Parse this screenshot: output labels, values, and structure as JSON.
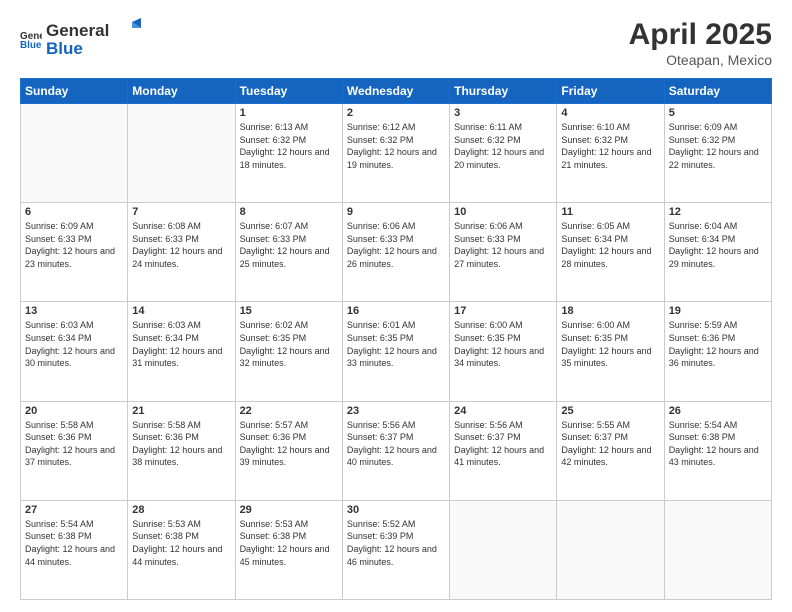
{
  "header": {
    "logo_general": "General",
    "logo_blue": "Blue",
    "title": "April 2025",
    "location": "Oteapan, Mexico"
  },
  "days_of_week": [
    "Sunday",
    "Monday",
    "Tuesday",
    "Wednesday",
    "Thursday",
    "Friday",
    "Saturday"
  ],
  "weeks": [
    [
      {
        "day": "",
        "info": ""
      },
      {
        "day": "",
        "info": ""
      },
      {
        "day": "1",
        "info": "Sunrise: 6:13 AM\nSunset: 6:32 PM\nDaylight: 12 hours and 18 minutes."
      },
      {
        "day": "2",
        "info": "Sunrise: 6:12 AM\nSunset: 6:32 PM\nDaylight: 12 hours and 19 minutes."
      },
      {
        "day": "3",
        "info": "Sunrise: 6:11 AM\nSunset: 6:32 PM\nDaylight: 12 hours and 20 minutes."
      },
      {
        "day": "4",
        "info": "Sunrise: 6:10 AM\nSunset: 6:32 PM\nDaylight: 12 hours and 21 minutes."
      },
      {
        "day": "5",
        "info": "Sunrise: 6:09 AM\nSunset: 6:32 PM\nDaylight: 12 hours and 22 minutes."
      }
    ],
    [
      {
        "day": "6",
        "info": "Sunrise: 6:09 AM\nSunset: 6:33 PM\nDaylight: 12 hours and 23 minutes."
      },
      {
        "day": "7",
        "info": "Sunrise: 6:08 AM\nSunset: 6:33 PM\nDaylight: 12 hours and 24 minutes."
      },
      {
        "day": "8",
        "info": "Sunrise: 6:07 AM\nSunset: 6:33 PM\nDaylight: 12 hours and 25 minutes."
      },
      {
        "day": "9",
        "info": "Sunrise: 6:06 AM\nSunset: 6:33 PM\nDaylight: 12 hours and 26 minutes."
      },
      {
        "day": "10",
        "info": "Sunrise: 6:06 AM\nSunset: 6:33 PM\nDaylight: 12 hours and 27 minutes."
      },
      {
        "day": "11",
        "info": "Sunrise: 6:05 AM\nSunset: 6:34 PM\nDaylight: 12 hours and 28 minutes."
      },
      {
        "day": "12",
        "info": "Sunrise: 6:04 AM\nSunset: 6:34 PM\nDaylight: 12 hours and 29 minutes."
      }
    ],
    [
      {
        "day": "13",
        "info": "Sunrise: 6:03 AM\nSunset: 6:34 PM\nDaylight: 12 hours and 30 minutes."
      },
      {
        "day": "14",
        "info": "Sunrise: 6:03 AM\nSunset: 6:34 PM\nDaylight: 12 hours and 31 minutes."
      },
      {
        "day": "15",
        "info": "Sunrise: 6:02 AM\nSunset: 6:35 PM\nDaylight: 12 hours and 32 minutes."
      },
      {
        "day": "16",
        "info": "Sunrise: 6:01 AM\nSunset: 6:35 PM\nDaylight: 12 hours and 33 minutes."
      },
      {
        "day": "17",
        "info": "Sunrise: 6:00 AM\nSunset: 6:35 PM\nDaylight: 12 hours and 34 minutes."
      },
      {
        "day": "18",
        "info": "Sunrise: 6:00 AM\nSunset: 6:35 PM\nDaylight: 12 hours and 35 minutes."
      },
      {
        "day": "19",
        "info": "Sunrise: 5:59 AM\nSunset: 6:36 PM\nDaylight: 12 hours and 36 minutes."
      }
    ],
    [
      {
        "day": "20",
        "info": "Sunrise: 5:58 AM\nSunset: 6:36 PM\nDaylight: 12 hours and 37 minutes."
      },
      {
        "day": "21",
        "info": "Sunrise: 5:58 AM\nSunset: 6:36 PM\nDaylight: 12 hours and 38 minutes."
      },
      {
        "day": "22",
        "info": "Sunrise: 5:57 AM\nSunset: 6:36 PM\nDaylight: 12 hours and 39 minutes."
      },
      {
        "day": "23",
        "info": "Sunrise: 5:56 AM\nSunset: 6:37 PM\nDaylight: 12 hours and 40 minutes."
      },
      {
        "day": "24",
        "info": "Sunrise: 5:56 AM\nSunset: 6:37 PM\nDaylight: 12 hours and 41 minutes."
      },
      {
        "day": "25",
        "info": "Sunrise: 5:55 AM\nSunset: 6:37 PM\nDaylight: 12 hours and 42 minutes."
      },
      {
        "day": "26",
        "info": "Sunrise: 5:54 AM\nSunset: 6:38 PM\nDaylight: 12 hours and 43 minutes."
      }
    ],
    [
      {
        "day": "27",
        "info": "Sunrise: 5:54 AM\nSunset: 6:38 PM\nDaylight: 12 hours and 44 minutes."
      },
      {
        "day": "28",
        "info": "Sunrise: 5:53 AM\nSunset: 6:38 PM\nDaylight: 12 hours and 44 minutes."
      },
      {
        "day": "29",
        "info": "Sunrise: 5:53 AM\nSunset: 6:38 PM\nDaylight: 12 hours and 45 minutes."
      },
      {
        "day": "30",
        "info": "Sunrise: 5:52 AM\nSunset: 6:39 PM\nDaylight: 12 hours and 46 minutes."
      },
      {
        "day": "",
        "info": ""
      },
      {
        "day": "",
        "info": ""
      },
      {
        "day": "",
        "info": ""
      }
    ]
  ]
}
